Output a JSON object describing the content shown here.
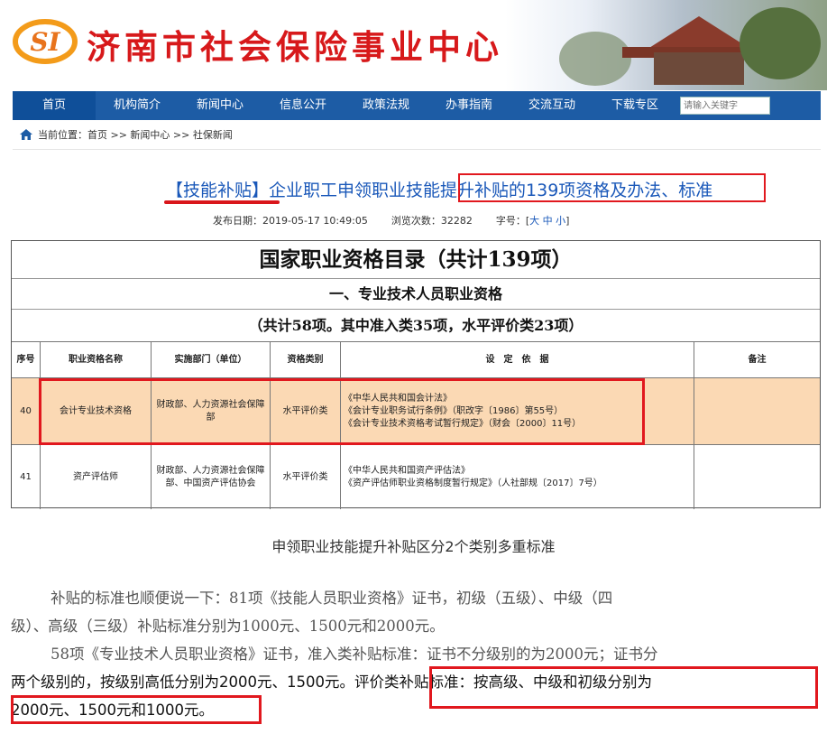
{
  "header": {
    "logo_text": "SI",
    "site_title": "济南市社会保险事业中心"
  },
  "nav": {
    "items": [
      "首页",
      "机构简介",
      "新闻中心",
      "信息公开",
      "政策法规",
      "办事指南",
      "交流互动",
      "下载专区"
    ],
    "search_placeholder": "请输入关键字"
  },
  "breadcrumb": {
    "text": "当前位置：首页 >> 新闻中心 >> 社保新闻"
  },
  "article": {
    "tag": "【技能补贴】",
    "title_rest": "企业职工申领职业技能提升补贴的139项资格及办法、标准",
    "publish_date": "发布日期：2019-05-17 10:49:05",
    "views": "浏览次数：32282",
    "font_size_label": "字号：[",
    "font_sizes": "大 中 小",
    "font_size_close": "]"
  },
  "table": {
    "title": "国家职业资格目录（共计139项）",
    "subtitle": "一、专业技术人员职业资格",
    "count_line": "（共计58项。其中准入类35项，水平评价类23项）",
    "headers": [
      "序号",
      "职业资格名称",
      "实施部门（单位）",
      "资格类别",
      "设　定　依　据",
      "备注"
    ],
    "rows": [
      {
        "no": "40",
        "name": "会计专业技术资格",
        "dept": "财政部、人力资源社会保障部",
        "type": "水平评价类",
        "basis": [
          "《中华人民共和国会计法》",
          "《会计专业职务试行条例》（职改字〔1986〕第55号）",
          "《会计专业技术资格考试暂行规定》（财会〔2000〕11号）"
        ],
        "note": ""
      },
      {
        "no": "41",
        "name": "资产评估师",
        "dept": "财政部、人力资源社会保障部、中国资产评估协会",
        "type": "水平评价类",
        "basis": [
          "《中华人民共和国资产评估法》",
          "《资产评估师职业资格制度暂行规定》（人社部规〔2017〕7号）"
        ],
        "note": ""
      }
    ]
  },
  "body": {
    "caption": "申领职业技能提升补贴区分2个类别多重标准",
    "p1_line1": "补贴的标准也顺便说一下：81项《技能人员职业资格》证书，初级（五级）、中级（四",
    "p1_line2": "级）、高级（三级）补贴标准分别为1000元、1500元和2000元。",
    "p2_line1": "58项《专业技术人员职业资格》证书，准入类补贴标准：证书不分级别的为2000元；证书分",
    "p2_line2": "两个级别的，按级别高低分别为2000元、1500元。评价类补贴标准：按高级、中级和初级分别为",
    "p2_line3": "2000元、1500元和1000元。"
  },
  "colors": {
    "nav_blue": "#1d5ca5",
    "title_red": "#d7191b",
    "link_blue": "#1a58b9",
    "highlight_row": "#fbd9b4",
    "annotation_red": "#e1181e"
  }
}
